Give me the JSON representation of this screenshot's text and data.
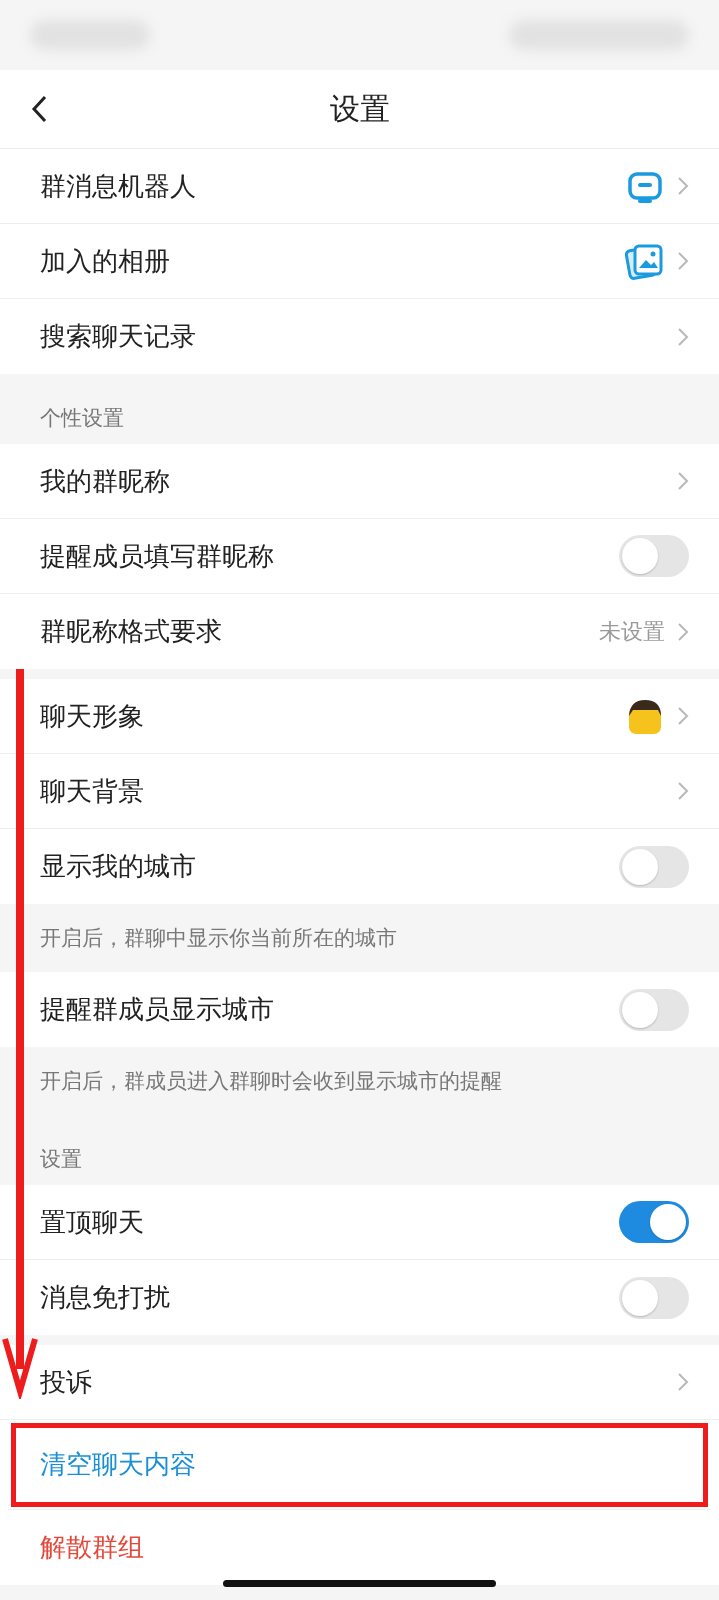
{
  "header": {
    "title": "设置"
  },
  "sections": [
    {
      "kind": "rows",
      "rows": [
        {
          "label": "群消息机器人",
          "kind": "chevron"
        },
        {
          "label": "加入的相册",
          "kind": "chevron"
        },
        {
          "label": "搜索聊天记录",
          "kind": "chevron"
        }
      ]
    },
    {
      "kind": "heading",
      "text": "个性设置"
    },
    {
      "kind": "rows",
      "rows": [
        {
          "label": "我的群昵称",
          "kind": "chevron"
        },
        {
          "label": "提醒成员填写群昵称",
          "kind": "toggle",
          "on": false
        },
        {
          "label": "群昵称格式要求",
          "kind": "chevron",
          "value": "未设置"
        }
      ]
    },
    {
      "kind": "gap"
    },
    {
      "kind": "rows",
      "rows": [
        {
          "label": "聊天形象",
          "kind": "chevron"
        },
        {
          "label": "聊天背景",
          "kind": "chevron"
        },
        {
          "label": "显示我的城市",
          "kind": "toggle",
          "on": false
        }
      ]
    },
    {
      "kind": "note",
      "text": "开启后，群聊中显示你当前所在的城市"
    },
    {
      "kind": "rows",
      "rows": [
        {
          "label": "提醒群成员显示城市",
          "kind": "toggle",
          "on": false
        }
      ]
    },
    {
      "kind": "note",
      "text": "开启后，群成员进入群聊时会收到显示城市的提醒"
    },
    {
      "kind": "heading",
      "text": "设置"
    },
    {
      "kind": "rows",
      "rows": [
        {
          "label": "置顶聊天",
          "kind": "toggle",
          "on": true
        },
        {
          "label": "消息免打扰",
          "kind": "toggle",
          "on": false
        }
      ]
    },
    {
      "kind": "gap"
    },
    {
      "kind": "rows",
      "rows": [
        {
          "label": "投诉",
          "kind": "chevron"
        },
        {
          "label": "清空聊天内容",
          "kind": "link",
          "highlighted": true
        },
        {
          "label": "解散群组",
          "kind": "danger"
        }
      ]
    }
  ]
}
